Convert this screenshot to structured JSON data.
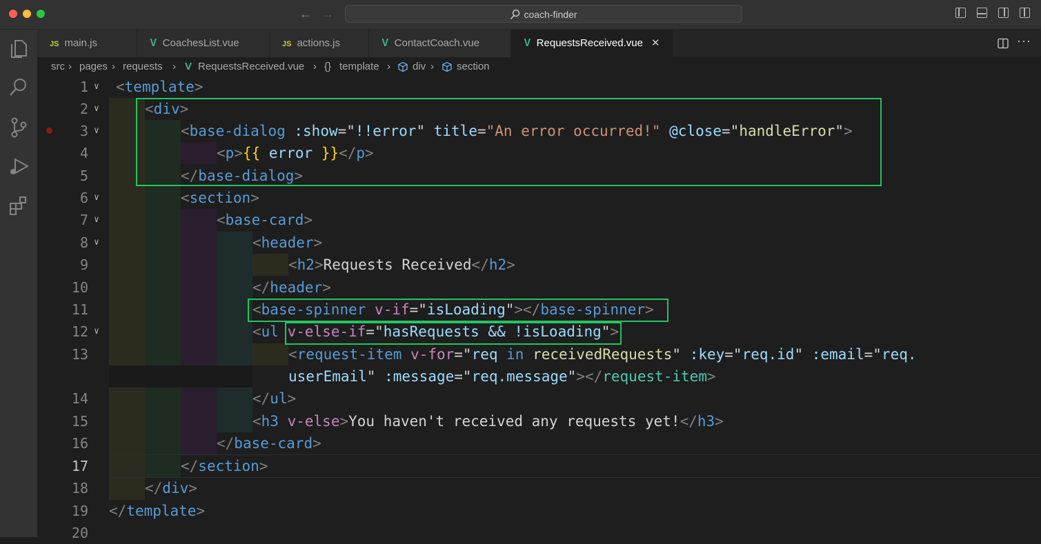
{
  "window": {
    "search_text": "coach-finder",
    "traffic_lights": [
      "#ff5f57",
      "#febc2e",
      "#28c840"
    ]
  },
  "activity_bar": [
    {
      "icon": "explorer-icon"
    },
    {
      "icon": "search-icon"
    },
    {
      "icon": "source-control-icon"
    },
    {
      "icon": "run-debug-icon"
    },
    {
      "icon": "extensions-icon"
    }
  ],
  "tabs": [
    {
      "badge": "JS",
      "label": "main.js",
      "active": false
    },
    {
      "badge": "V",
      "label": "CoachesList.vue",
      "active": false
    },
    {
      "badge": "JS",
      "label": "actions.js",
      "active": false
    },
    {
      "badge": "V",
      "label": "ContactCoach.vue",
      "active": false
    },
    {
      "badge": "V",
      "label": "RequestsReceived.vue",
      "active": true
    }
  ],
  "breadcrumb": [
    "src",
    "pages",
    "requests",
    "RequestsReceived.vue",
    "template",
    "div",
    "section"
  ],
  "editor": {
    "current_line": 17,
    "breakpoint_line": 3,
    "line_numbers": [
      "1",
      "2",
      "3",
      "4",
      "5",
      "6",
      "7",
      "8",
      "9",
      "10",
      "11",
      "12",
      "13",
      "14",
      "15",
      "16",
      "17",
      "18",
      "19",
      "20"
    ]
  },
  "colors": {
    "highlight_box": "#22c55e",
    "tag": "#569cd6",
    "attribute": "#9cdcfe",
    "directive": "#c586c0",
    "string": "#ce9178",
    "expression": "#dcdcaa",
    "mustache": "#ffd700"
  },
  "code": {
    "l1": {
      "a": "<",
      "tag": "template",
      "b": ">"
    },
    "l2": {
      "a": "<",
      "tag": "div",
      "b": ">"
    },
    "l3": {
      "a": "<",
      "tag": "base-dialog",
      "attr1": ":show",
      "eq1": "=",
      "q1": "\"",
      "val1": "!!error",
      "q2": "\"",
      "attr2": "title",
      "eq2": "=",
      "val2": "\"An error occurred!\"",
      "attr3": "@close",
      "eq3": "=",
      "q3": "\"",
      "val3": "handleError",
      "q4": "\"",
      "b": ">"
    },
    "l4": {
      "a": "<",
      "tag": "p",
      "b": ">",
      "open": "{{",
      "expr": " error ",
      "close": "}}",
      "c": "</",
      "tag2": "p",
      "d": ">"
    },
    "l5": {
      "a": "</",
      "tag": "base-dialog",
      "b": ">"
    },
    "l6": {
      "a": "<",
      "tag": "section",
      "b": ">"
    },
    "l7": {
      "a": "<",
      "tag": "base-card",
      "b": ">"
    },
    "l8": {
      "a": "<",
      "tag": "header",
      "b": ">"
    },
    "l9": {
      "a": "<",
      "tag": "h2",
      "b": ">",
      "text": "Requests Received",
      "c": "</",
      "tag2": "h2",
      "d": ">"
    },
    "l10": {
      "a": "</",
      "tag": "header",
      "b": ">"
    },
    "l11": {
      "a": "<",
      "tag": "base-spinner",
      "dir": "v-if",
      "eq": "=",
      "q1": "\"",
      "val": "isLoading",
      "q2": "\"",
      "b": "></",
      "tag2": "base-spinner",
      "c": ">"
    },
    "l12": {
      "a": "<",
      "tag": "ul",
      "dir": "v-else-if",
      "eq": "=",
      "q1": "\"",
      "val": "hasRequests && !isLoading",
      "q2": "\"",
      "b": ">"
    },
    "l13a": {
      "a": "<",
      "tag": "request-item",
      "dir": "v-for",
      "eq1": "=",
      "q1": "\"",
      "v1": "req",
      "kw": " in ",
      "v2": "receivedRequests",
      "q2": "\"",
      "attr2": ":key",
      "eq2": "=",
      "q3": "\"",
      "v3": "req.id",
      "q4": "\"",
      "attr3": ":email",
      "eq3": "=",
      "q5": "\"",
      "v4": "req."
    },
    "l13b": {
      "v5": "userEmail",
      "q6": "\"",
      "attr4": ":message",
      "eq4": "=",
      "q7": "\"",
      "v6": "req.message",
      "q8": "\"",
      "b": "></",
      "tag2": "request-item",
      "c": ">"
    },
    "l14": {
      "a": "</",
      "tag": "ul",
      "b": ">"
    },
    "l15": {
      "a": "<",
      "tag": "h3",
      "dir": "v-else",
      "b": ">",
      "text": "You haven't received any requests yet!",
      "c": "</",
      "tag2": "h3",
      "d": ">"
    },
    "l16": {
      "a": "</",
      "tag": "base-card",
      "b": ">"
    },
    "l17": {
      "a": "</",
      "tag": "section",
      "b": ">"
    },
    "l18": {
      "a": "</",
      "tag": "div",
      "b": ">"
    },
    "l19": {
      "a": "</",
      "tag": "template",
      "b": ">"
    }
  }
}
